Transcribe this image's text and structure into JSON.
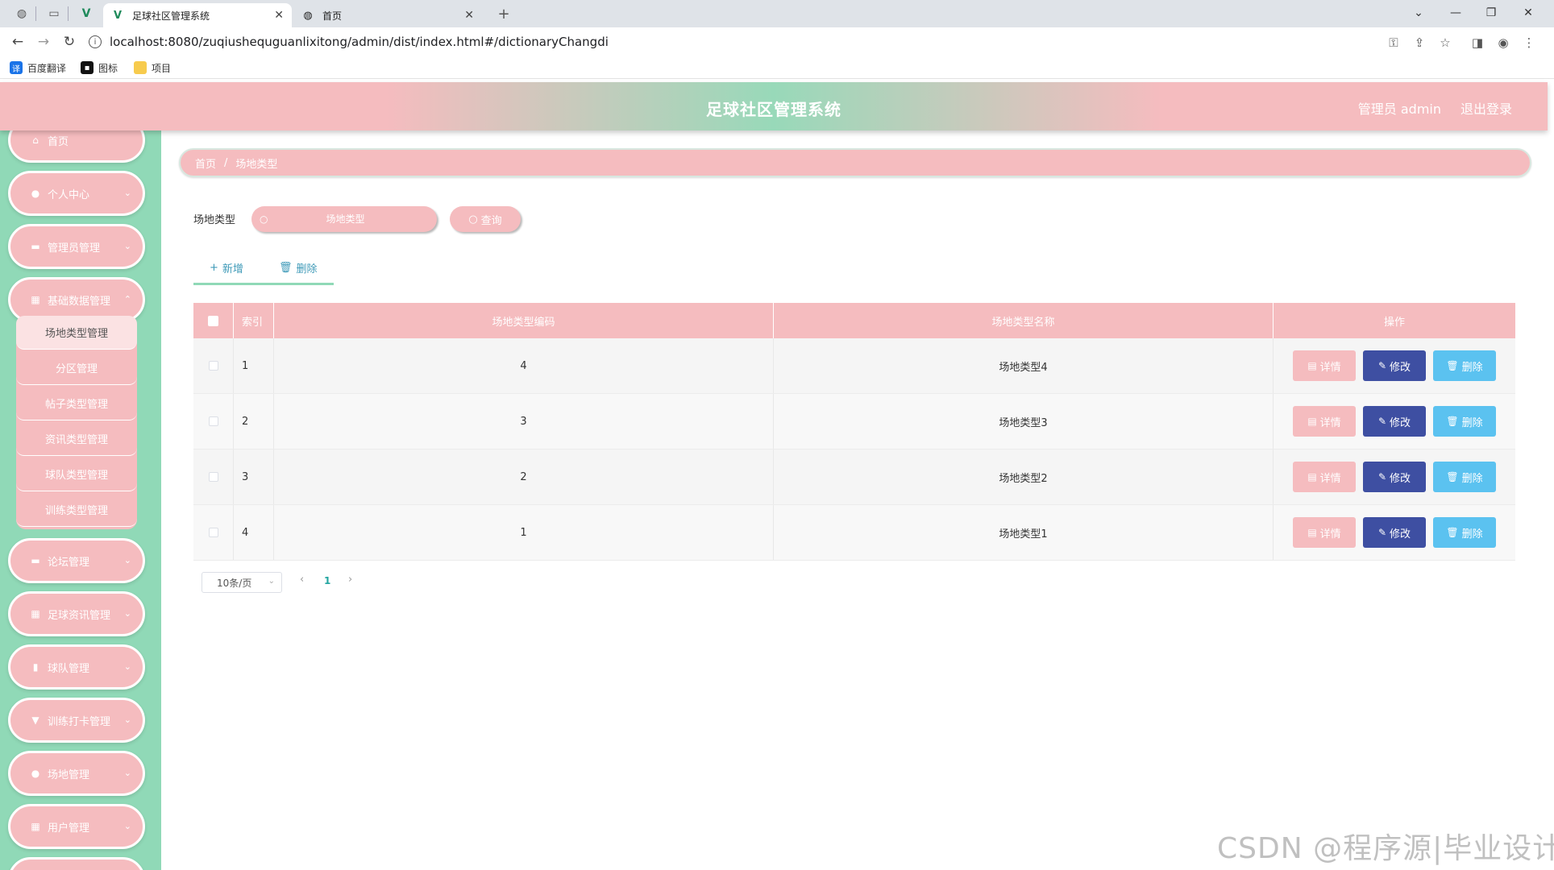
{
  "browser": {
    "tabs": [
      {
        "title": "足球社区管理系统",
        "active": true
      },
      {
        "title": "首页",
        "active": false
      }
    ],
    "url": "localhost:8080/zuqiushequguanlixitong/admin/dist/index.html#/dictionaryChangdi",
    "bookmarks": [
      "百度翻译",
      "图标",
      "项目"
    ]
  },
  "header": {
    "title": "足球社区管理系统",
    "user": "管理员 admin",
    "logout": "退出登录"
  },
  "sidebar": {
    "items": [
      {
        "label": "首页",
        "icon": "home-icon"
      },
      {
        "label": "个人中心",
        "icon": "user-icon"
      },
      {
        "label": "管理员管理",
        "icon": "chat-icon"
      },
      {
        "label": "基础数据管理",
        "icon": "grid-icon"
      },
      {
        "label": "论坛管理",
        "icon": "monitor-icon"
      },
      {
        "label": "足球资讯管理",
        "icon": "grid-icon"
      },
      {
        "label": "球队管理",
        "icon": "chart-icon"
      },
      {
        "label": "训练打卡管理",
        "icon": "trophy-icon"
      },
      {
        "label": "场地管理",
        "icon": "user-icon"
      },
      {
        "label": "用户管理",
        "icon": "grid-icon"
      }
    ],
    "submenu": [
      "场地类型管理",
      "分区管理",
      "帖子类型管理",
      "资讯类型管理",
      "球队类型管理",
      "训练类型管理"
    ]
  },
  "breadcrumb": {
    "home": "首页",
    "sep": "/",
    "current": "场地类型"
  },
  "search": {
    "label": "场地类型",
    "placeholder": "场地类型",
    "button": "查询"
  },
  "actions": {
    "add": "新增",
    "delete": "删除"
  },
  "table": {
    "columns": {
      "index": "索引",
      "code": "场地类型编码",
      "name": "场地类型名称",
      "ops": "操作"
    },
    "rows": [
      {
        "index": "1",
        "code": "4",
        "name": "场地类型4"
      },
      {
        "index": "2",
        "code": "3",
        "name": "场地类型3"
      },
      {
        "index": "3",
        "code": "2",
        "name": "场地类型2"
      },
      {
        "index": "4",
        "code": "1",
        "name": "场地类型1"
      }
    ],
    "buttons": {
      "detail": "详情",
      "edit": "修改",
      "delete": "删除"
    }
  },
  "pagination": {
    "page_size": "10条/页",
    "current_page": "1"
  },
  "watermark": "CSDN @程序源|毕业设计",
  "colors": {
    "pink": "#f5bcbf",
    "green": "#90d9b7",
    "edit": "#3e4fa2",
    "delete": "#5bc2f0"
  }
}
